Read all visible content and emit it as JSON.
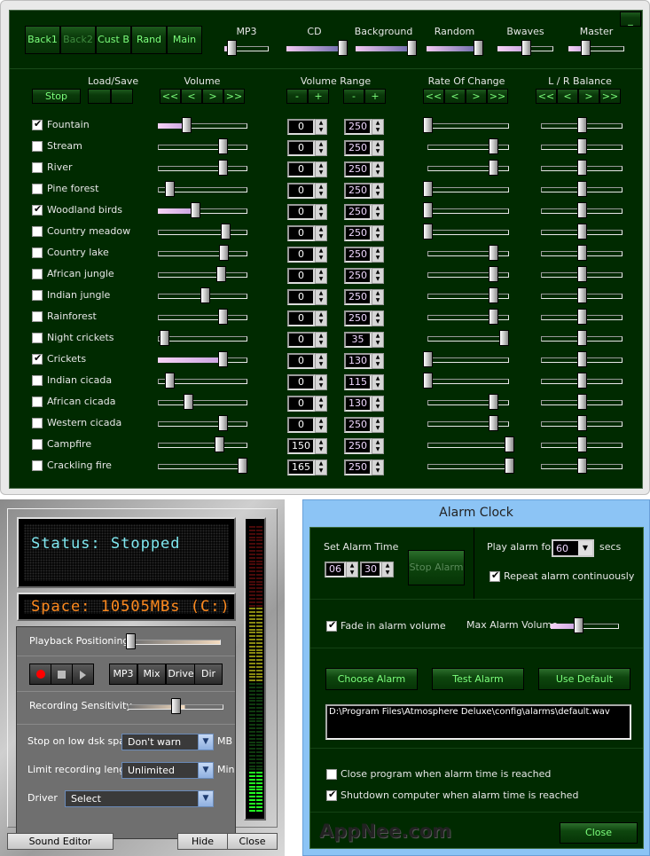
{
  "mixer": {
    "preset_buttons": [
      {
        "label": "Back1",
        "enabled": true
      },
      {
        "label": "Back2",
        "enabled": false
      },
      {
        "label": "Cust B",
        "enabled": true
      },
      {
        "label": "Rand",
        "enabled": true
      },
      {
        "label": "Main",
        "enabled": true
      }
    ],
    "master_sliders": [
      {
        "label": "MP3",
        "value": 0.15
      },
      {
        "label": "CD",
        "value": 1.0
      },
      {
        "label": "Background",
        "value": 1.0
      },
      {
        "label": "Random",
        "value": 0.92
      },
      {
        "label": "Bwaves",
        "value": 0.5
      },
      {
        "label": "Master",
        "value": 0.3
      }
    ],
    "minimize_label": "_",
    "column_headers": {
      "load_save": "Load/Save",
      "volume": "Volume",
      "volume_range": "Volume Range",
      "rate_of_change": "Rate Of Change",
      "balance": "L / R Balance"
    },
    "stop_label": "Stop",
    "nav_buttons": [
      "<<",
      "<",
      ">",
      ">>"
    ],
    "range_buttons": [
      "-",
      "+"
    ],
    "sounds": [
      {
        "name": "Fountain",
        "checked": true,
        "volume": 0.32,
        "min": "0",
        "max": "250",
        "rate": 0.0,
        "balance": 0.5
      },
      {
        "name": "Stream",
        "checked": false,
        "volume": 0.72,
        "min": "0",
        "max": "250",
        "rate": 0.8,
        "balance": 0.5
      },
      {
        "name": "River",
        "checked": false,
        "volume": 0.72,
        "min": "0",
        "max": "250",
        "rate": 0.8,
        "balance": 0.5
      },
      {
        "name": "Pine forest",
        "checked": false,
        "volume": 0.13,
        "min": "0",
        "max": "250",
        "rate": 0.0,
        "balance": 0.5
      },
      {
        "name": "Woodland birds",
        "checked": true,
        "volume": 0.42,
        "min": "0",
        "max": "250",
        "rate": 0.0,
        "balance": 0.5
      },
      {
        "name": "Country meadow",
        "checked": false,
        "volume": 0.75,
        "min": "0",
        "max": "250",
        "rate": 0.0,
        "balance": 0.5
      },
      {
        "name": "Country lake",
        "checked": false,
        "volume": 0.73,
        "min": "0",
        "max": "250",
        "rate": 0.8,
        "balance": 0.5
      },
      {
        "name": "African jungle",
        "checked": false,
        "volume": 0.7,
        "min": "0",
        "max": "250",
        "rate": 0.8,
        "balance": 0.5
      },
      {
        "name": "Indian jungle",
        "checked": false,
        "volume": 0.52,
        "min": "0",
        "max": "250",
        "rate": 0.8,
        "balance": 0.5
      },
      {
        "name": "Rainforest",
        "checked": false,
        "volume": 0.72,
        "min": "0",
        "max": "250",
        "rate": 0.8,
        "balance": 0.5
      },
      {
        "name": "Night crickets",
        "checked": false,
        "volume": 0.07,
        "min": "0",
        "max": "35",
        "rate": 0.93,
        "balance": 0.5
      },
      {
        "name": "Crickets",
        "checked": true,
        "volume": 0.72,
        "min": "0",
        "max": "130",
        "rate": 0.0,
        "balance": 0.5
      },
      {
        "name": "Indian cicada",
        "checked": false,
        "volume": 0.13,
        "min": "0",
        "max": "115",
        "rate": 0.0,
        "balance": 0.5
      },
      {
        "name": "African cicada",
        "checked": false,
        "volume": 0.34,
        "min": "0",
        "max": "130",
        "rate": 0.8,
        "balance": 0.5
      },
      {
        "name": "Western cicada",
        "checked": false,
        "volume": 0.72,
        "min": "0",
        "max": "250",
        "rate": 0.8,
        "balance": 0.5
      },
      {
        "name": "Campfire",
        "checked": false,
        "volume": 0.68,
        "min": "150",
        "max": "250",
        "rate": 1.0,
        "balance": 0.5
      },
      {
        "name": "Crackling fire",
        "checked": false,
        "volume": 0.94,
        "min": "165",
        "max": "250",
        "rate": 1.0,
        "balance": 0.5
      }
    ]
  },
  "recorder": {
    "status_text": "Status: Stopped",
    "space_text": "Space: 10505MBs (C:)",
    "status_color": "#7fe8f0",
    "space_color": "#ff8a1e",
    "playback_label": "Playback Positioning",
    "playback_value": 0.0,
    "transport": [
      "record",
      "stop",
      "play"
    ],
    "mode_buttons": [
      "MP3",
      "Mix",
      "Drive",
      "Dir"
    ],
    "sensitivity_label": "Recording Sensitivity",
    "sensitivity_value": 0.5,
    "low_disk_label": "Stop on low dsk space",
    "low_disk_value": "Don't warn",
    "low_disk_unit": "MB",
    "limit_label": "Limit recording length",
    "limit_value": "Unlimited",
    "limit_unit": "Min",
    "driver_label": "Driver",
    "driver_value": "Select",
    "sound_editor_label": "Sound Editor",
    "hide_label": "Hide",
    "close_label": "Close",
    "vu_level": 0.11
  },
  "alarm": {
    "title": "Alarm Clock",
    "set_time_label": "Set Alarm Time",
    "hour": "06",
    "minute": "30",
    "stop_alarm_label": "Stop Alarm",
    "play_for_label": "Play alarm for",
    "play_for_value": "60",
    "secs_label": "secs",
    "repeat_label": "Repeat alarm continuously",
    "repeat_checked": true,
    "fade_label": "Fade in alarm volume",
    "fade_checked": true,
    "max_volume_label": "Max Alarm Volume",
    "max_volume_value": 0.4,
    "choose_label": "Choose Alarm",
    "test_label": "Test Alarm",
    "default_label": "Use Default",
    "path": "D:\\Program Files\\Atmosphere Deluxe\\config\\alarms\\default.wav",
    "close_program_label": "Close program when alarm time is reached",
    "close_program_checked": false,
    "shutdown_label": "Shutdown computer when alarm time is reached",
    "shutdown_checked": true,
    "close_label": "Close",
    "watermark": "AppNee.com"
  }
}
